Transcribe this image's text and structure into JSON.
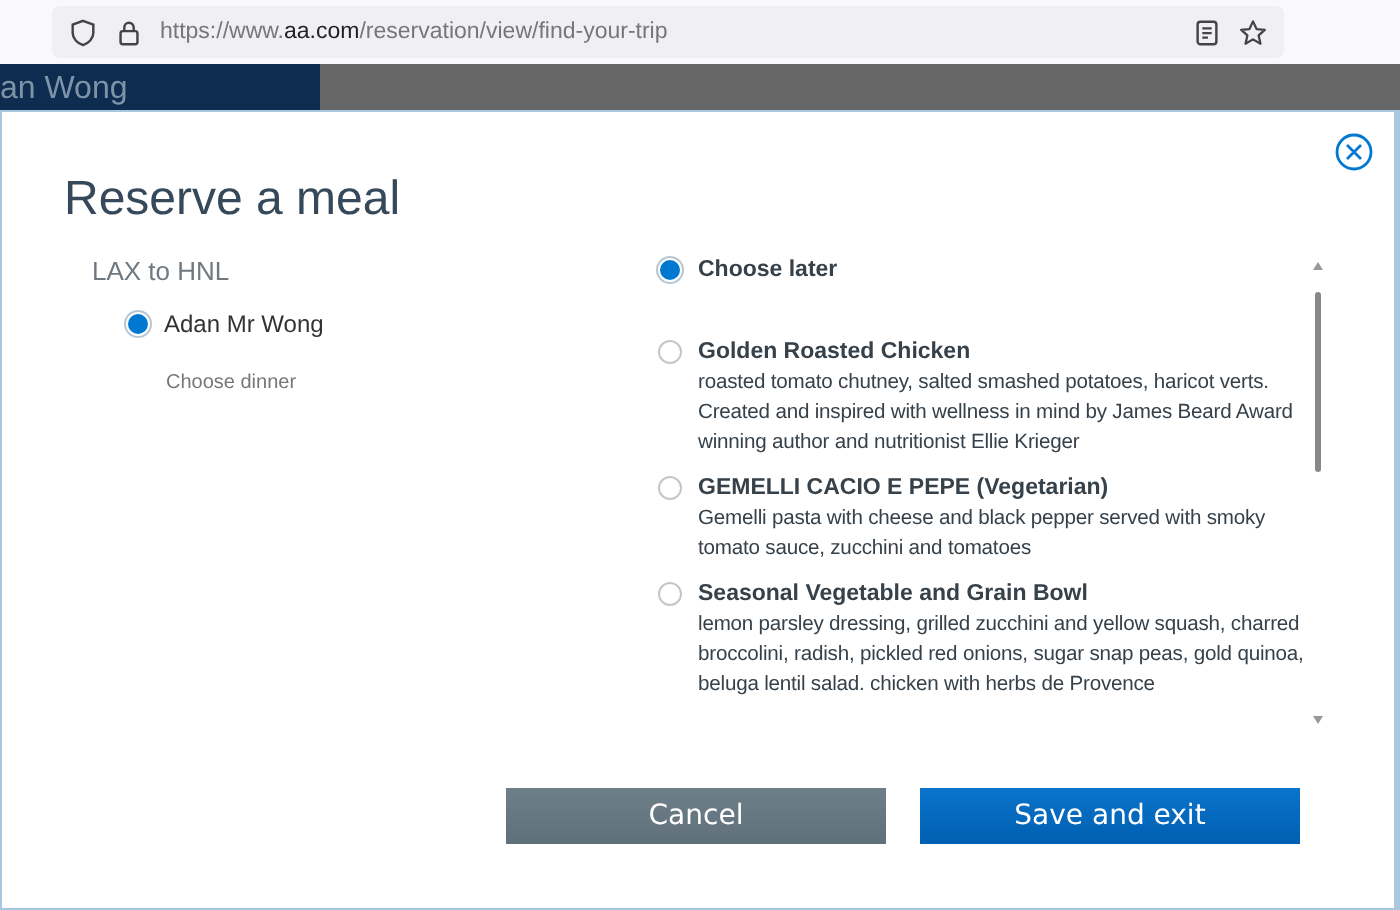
{
  "browser": {
    "url_start": "https://www.",
    "url_host": "aa.com",
    "url_end": "/reservation/view/find-your-trip"
  },
  "page_behind": {
    "passenger_name": "an Wong"
  },
  "dialog": {
    "title": "Reserve a meal",
    "route": "LAX to HNL",
    "passengers": [
      {
        "name": "Adan Mr Wong",
        "selected": true,
        "meal_prompt": "Choose dinner"
      }
    ],
    "meals": [
      {
        "name": "Choose later",
        "selected": true
      },
      {
        "name": "Golden Roasted Chicken",
        "description": "roasted tomato chutney, salted smashed potatoes, haricot verts. Created and inspired with wellness in mind by James Beard Award winning author and nutritionist Ellie Krieger",
        "selected": false
      },
      {
        "name": "GEMELLI CACIO E PEPE (Vegetarian)",
        "description": "Gemelli pasta with cheese and black pepper served with smoky tomato sauce, zucchini and tomatoes",
        "selected": false
      },
      {
        "name": "Seasonal Vegetable and Grain Bowl",
        "description": "lemon parsley dressing, grilled zucchini and yellow squash, charred broccolini, radish, pickled red onions, sugar snap peas, gold quinoa, beluga lentil salad. chicken with herbs de Provence",
        "selected": false
      }
    ],
    "buttons": [
      {
        "label": "Cancel",
        "kind": "secondary"
      },
      {
        "label": "Save and exit",
        "kind": "primary"
      }
    ]
  }
}
